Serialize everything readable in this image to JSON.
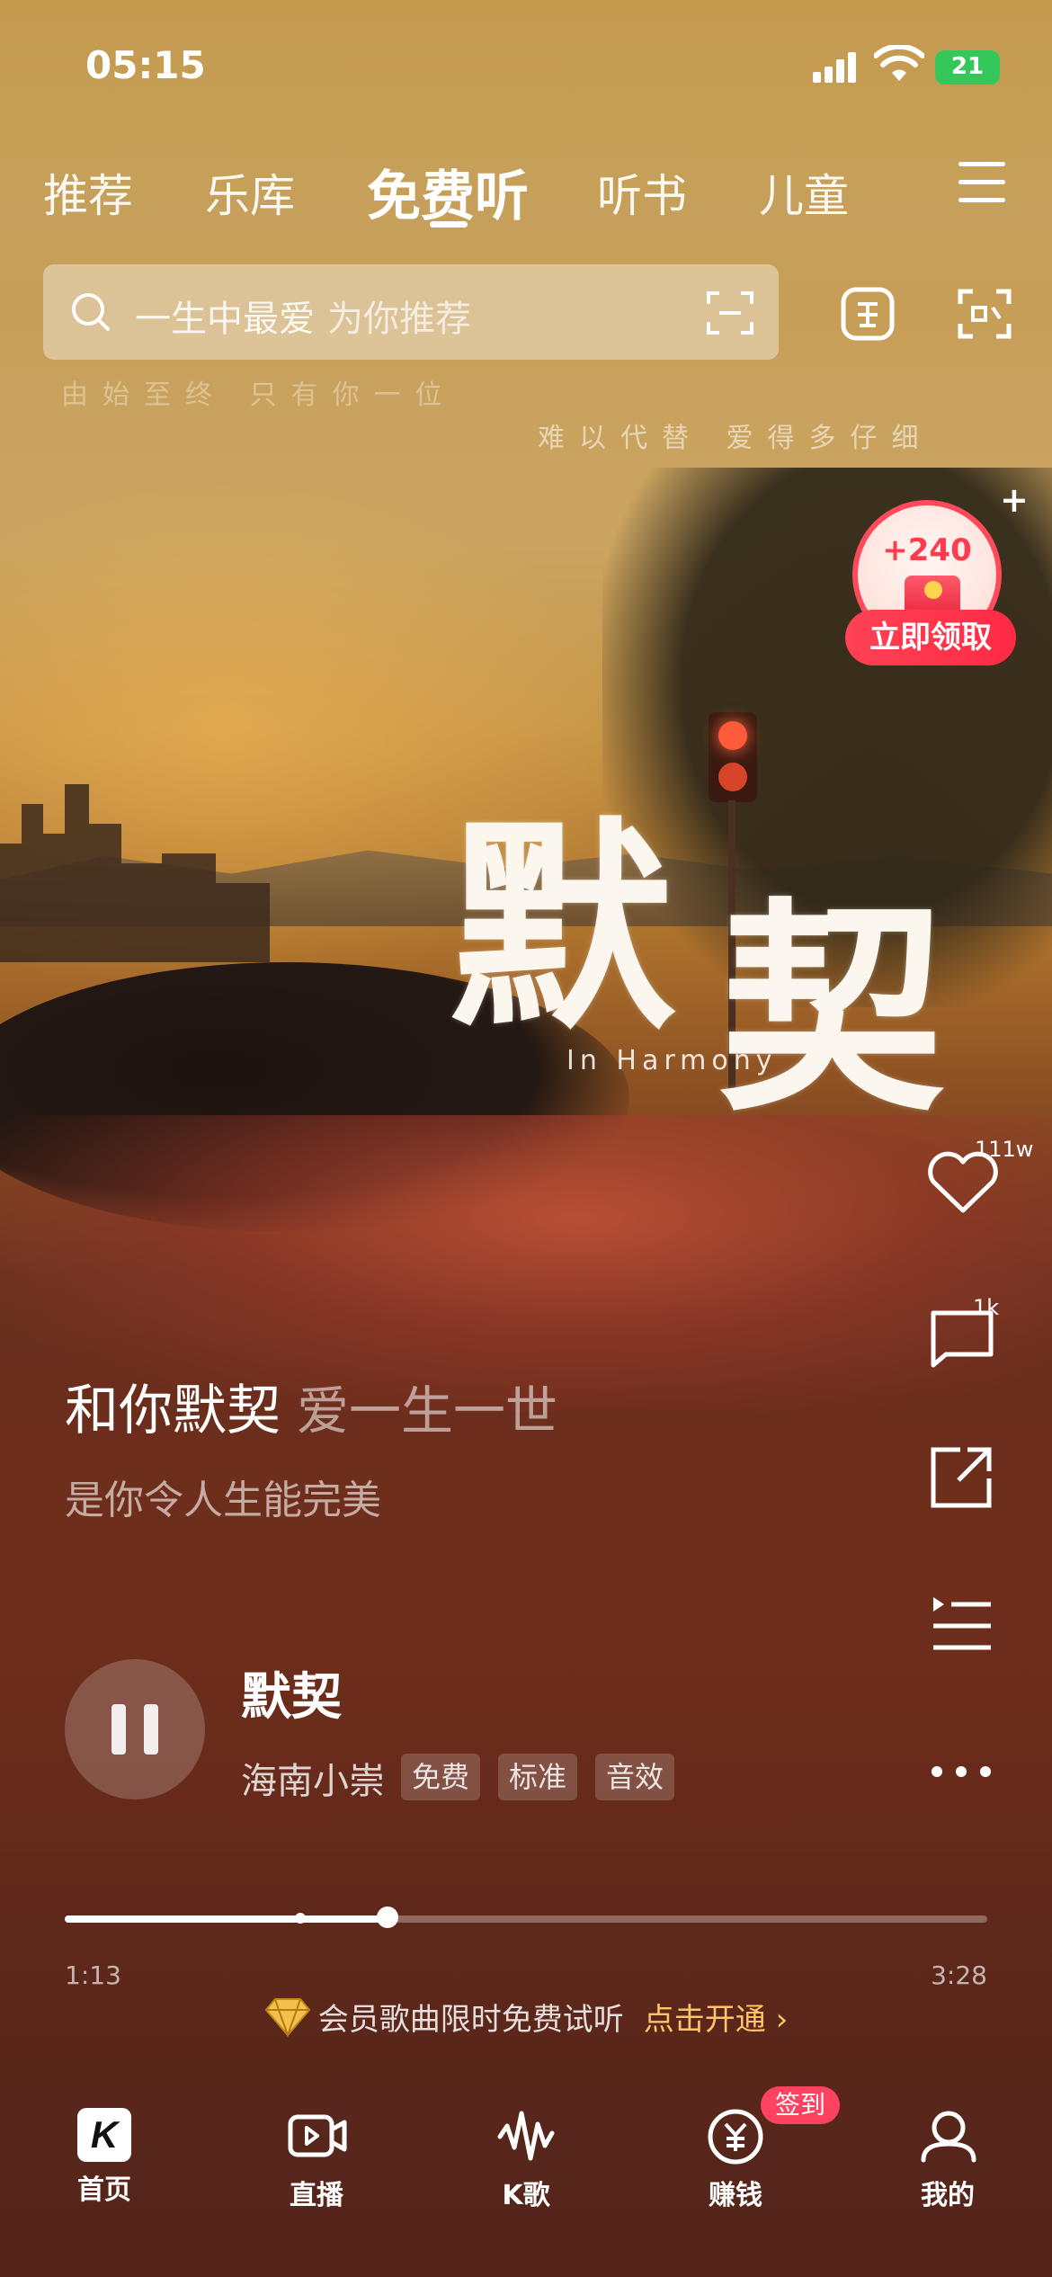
{
  "status_bar": {
    "time": "05:15",
    "battery": "21"
  },
  "tabs": [
    {
      "label": "推荐"
    },
    {
      "label": "乐库"
    },
    {
      "label": "免费听",
      "active": true
    },
    {
      "label": "听书"
    },
    {
      "label": "儿童"
    }
  ],
  "search": {
    "placeholder": "一生中最爱",
    "hint": "为你推荐"
  },
  "artwork": {
    "line_left": "由始至终 只有你一位",
    "line_right": "难以代替 爱得多仔细",
    "title_char_1": "默",
    "title_char_2": "契",
    "subtitle": "In Harmony"
  },
  "reward": {
    "amount": "+240",
    "cta": "立即领取"
  },
  "side_actions": {
    "likes": "111w",
    "comments": "1k"
  },
  "lyrics": {
    "current": "和你默契",
    "next": "爱一生一世",
    "following": "是你令人生能完美"
  },
  "player": {
    "song_title": "默契",
    "artist": "海南小崇",
    "tags": [
      "免费",
      "标准",
      "音效"
    ],
    "time_current": "1:13",
    "time_total": "3:28",
    "progress": 0.35,
    "trial_mark": 0.255
  },
  "vip": {
    "message": "会员歌曲限时免费试听",
    "cta": "点击开通 ›"
  },
  "bottom_nav": {
    "items": [
      {
        "label": "首页",
        "icon": "home-k-icon"
      },
      {
        "label": "直播",
        "icon": "live-icon"
      },
      {
        "label": "K歌",
        "icon": "karaoke-icon"
      },
      {
        "label": "赚钱",
        "icon": "earn-coin-icon"
      },
      {
        "label": "我的",
        "icon": "profile-icon"
      }
    ],
    "home_glyph": "K",
    "earn_badge": "签到"
  },
  "colors": {
    "accent_red": "#ff4254",
    "vip_gold": "#ffc36a",
    "progress": "#ffffff"
  }
}
